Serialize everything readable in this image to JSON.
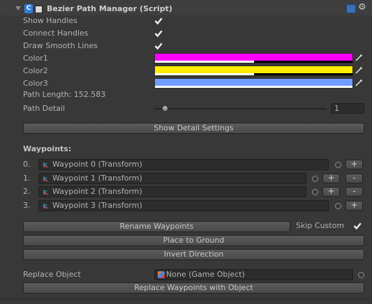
{
  "header": {
    "title": "Bezier Path Manager (Script)",
    "help_icon": "help-book-icon",
    "settings_icon": "gear-icon",
    "script_icon": "csharp-script-icon"
  },
  "toggles": [
    {
      "label": "Show Handles",
      "checked": true
    },
    {
      "label": "Connect Handles",
      "checked": true
    },
    {
      "label": "Draw Smooth Lines",
      "checked": true
    }
  ],
  "colors": [
    {
      "label": "Color1",
      "hex": "#ff00ff",
      "alpha": 0.5
    },
    {
      "label": "Color2",
      "hex": "#ffee00",
      "alpha": 0.5
    },
    {
      "label": "Color3",
      "hex": "#6f9cff",
      "alpha": 1.0
    }
  ],
  "path_length": "Path Length: 152.583",
  "path_detail": {
    "label": "Path Detail",
    "value": "1"
  },
  "buttons": {
    "show_detail": "Show Detail Settings",
    "rename": "Rename Waypoints",
    "place_ground": "Place to Ground",
    "invert": "Invert Direction",
    "replace_waypoints": "Replace Waypoints with Object"
  },
  "waypoints_heading": "Waypoints:",
  "waypoints": [
    {
      "index": "0.",
      "name": "Waypoint 0 (Transform)"
    },
    {
      "index": "1.",
      "name": "Waypoint 1 (Transform)"
    },
    {
      "index": "2.",
      "name": "Waypoint 2 (Transform)"
    },
    {
      "index": "3.",
      "name": "Waypoint 3 (Transform)"
    }
  ],
  "add_label": "+",
  "remove_label": "-",
  "skip_custom": {
    "label": "Skip Custom",
    "checked": true
  },
  "replace_object": {
    "label": "Replace Object",
    "value": "None (Game Object)"
  }
}
